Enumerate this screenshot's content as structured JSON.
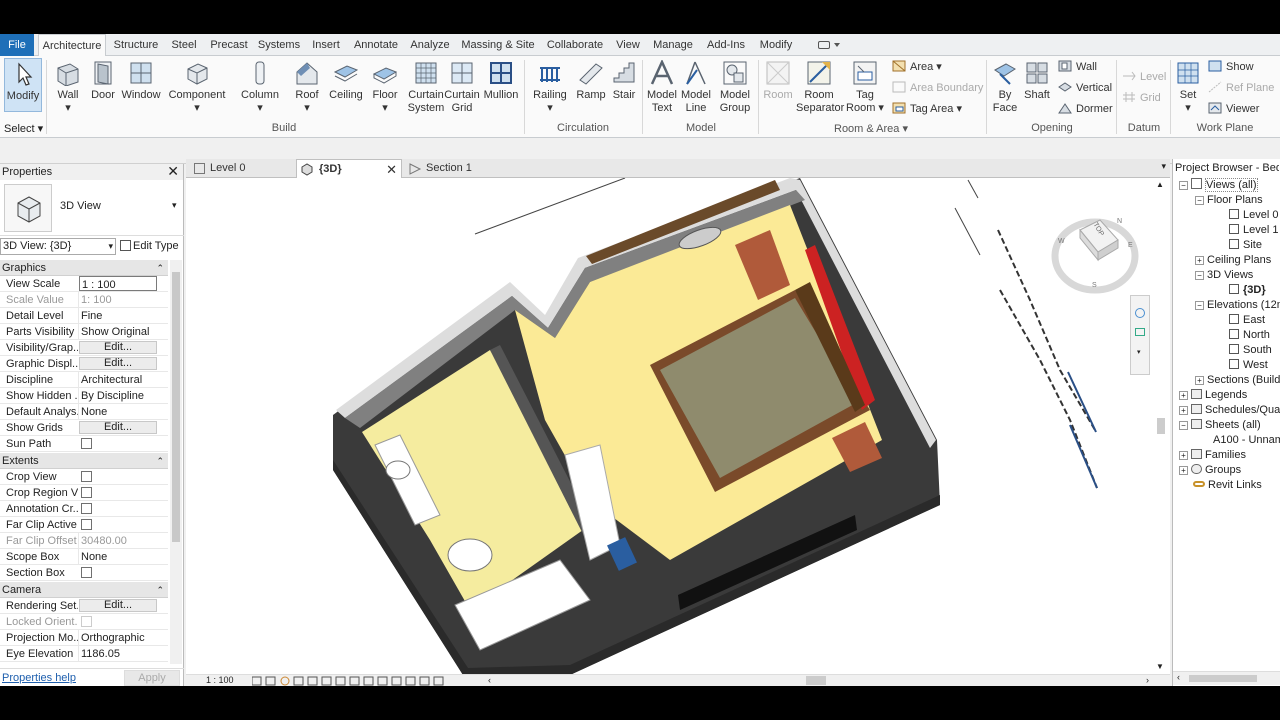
{
  "ribbon": {
    "tabs": [
      "File",
      "Architecture",
      "Structure",
      "Steel",
      "Precast",
      "Systems",
      "Insert",
      "Annotate",
      "Analyze",
      "Massing & Site",
      "Collaborate",
      "View",
      "Manage",
      "Add-Ins",
      "Modify"
    ],
    "modify": "Modify",
    "select": "Select",
    "build": {
      "wall": "Wall",
      "door": "Door",
      "window": "Window",
      "component": "Component",
      "column": "Column",
      "roof": "Roof",
      "ceiling": "Ceiling",
      "floor": "Floor",
      "curtain_system": "Curtain System",
      "curtain_grid": "Curtain Grid",
      "mullion": "Mullion",
      "label": "Build"
    },
    "circulation": {
      "railing": "Railing",
      "ramp": "Ramp",
      "stair": "Stair",
      "label": "Circulation"
    },
    "model": {
      "model_text": "Model Text",
      "model_line": "Model Line",
      "model_group": "Model Group",
      "label": "Model"
    },
    "room_area": {
      "room": "Room",
      "room_separator": "Room Separator",
      "tag_room": "Tag Room",
      "area": "Area",
      "area_boundary": "Area Boundary",
      "tag_area": "Tag Area",
      "label": "Room & Area"
    },
    "opening": {
      "by_face": "By Face",
      "shaft": "Shaft",
      "wall": "Wall",
      "vertical": "Vertical",
      "dormer": "Dormer",
      "label": "Opening"
    },
    "datum": {
      "level": "Level",
      "grid": "Grid",
      "label": "Datum"
    },
    "work_plane": {
      "set": "Set",
      "show": "Show",
      "ref_plane": "Ref Plane",
      "viewer": "Viewer",
      "label": "Work Plane"
    }
  },
  "properties": {
    "title": "Properties",
    "type_name": "3D View",
    "selector": "3D View: {3D}",
    "edit_type": "Edit Type",
    "sections": {
      "graphics": "Graphics",
      "extents": "Extents",
      "camera": "Camera"
    },
    "graphics_rows": [
      {
        "k": "View Scale",
        "v": "1 : 100"
      },
      {
        "k": "Scale Value",
        "v1": "1:",
        "v": "100"
      },
      {
        "k": "Detail Level",
        "v": "Fine"
      },
      {
        "k": "Parts Visibility",
        "v": "Show Original"
      },
      {
        "k": "Visibility/Grap...",
        "v": "Edit..."
      },
      {
        "k": "Graphic Displ...",
        "v": "Edit..."
      },
      {
        "k": "Discipline",
        "v": "Architectural"
      },
      {
        "k": "Show Hidden ...",
        "v": "By Discipline"
      },
      {
        "k": "Default Analys...",
        "v": "None"
      },
      {
        "k": "Show Grids",
        "v": "Edit..."
      },
      {
        "k": "Sun Path",
        "v": ""
      }
    ],
    "extents_rows": [
      {
        "k": "Crop View"
      },
      {
        "k": "Crop Region V..."
      },
      {
        "k": "Annotation Cr..."
      },
      {
        "k": "Far Clip Active"
      },
      {
        "k": "Far Clip Offset",
        "v": "30480.00"
      },
      {
        "k": "Scope Box",
        "v": "None"
      },
      {
        "k": "Section Box"
      }
    ],
    "camera_rows": [
      {
        "k": "Rendering Set...",
        "v": "Edit..."
      },
      {
        "k": "Locked Orient..."
      },
      {
        "k": "Projection Mo...",
        "v": "Orthographic"
      },
      {
        "k": "Eye Elevation",
        "v": "1186.05"
      }
    ],
    "help": "Properties help",
    "apply": "Apply"
  },
  "view_tabs": [
    "Level 0",
    "{3D}",
    "Section 1"
  ],
  "view_bar": {
    "scale": "1 : 100"
  },
  "viewcube": {
    "face": "TOP",
    "n": "N",
    "e": "E",
    "w": "W",
    "s": "S"
  },
  "project_browser": {
    "title": "Project Browser - Bed...",
    "items": [
      "Views (all)",
      "Floor Plans",
      "Level 0",
      "Level 1",
      "Site",
      "Ceiling Plans",
      "3D Views",
      "{3D}",
      "Elevations (12m",
      "East",
      "North",
      "South",
      "West",
      "Sections (Build",
      "Legends",
      "Schedules/Quan",
      "Sheets (all)",
      "A100 - Unnam",
      "Families",
      "Groups",
      "Revit Links"
    ]
  },
  "colors": {
    "accent": "#1e6fb8",
    "floor": "#fbea96",
    "wall": "#3c3c3c",
    "bed": "#8f8b6d"
  }
}
